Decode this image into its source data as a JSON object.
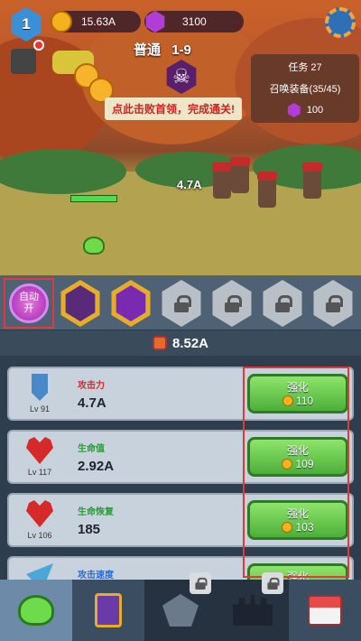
{
  "player": {
    "level": "1"
  },
  "resources": {
    "coins": "15.63A",
    "gems": "3100"
  },
  "stage": {
    "mode": "普通",
    "number": "1-9"
  },
  "boss_hint": "点此击败首领，完成通关!",
  "quest": {
    "title": "任务 27",
    "desc": "召唤装备(35/45)",
    "reward": "100"
  },
  "battle": {
    "damage_text": "4.7A"
  },
  "auto_button": {
    "line1": "自动",
    "line2": "开"
  },
  "power": "8.52A",
  "upgrades": [
    {
      "name": "攻击力",
      "name_color": "#d62a2a",
      "level": "Lv 91",
      "value": "4.7A",
      "button": "强化",
      "cost": "110"
    },
    {
      "name": "生命值",
      "name_color": "#2a9a3a",
      "level": "Lv 117",
      "value": "2.92A",
      "button": "强化",
      "cost": "109"
    },
    {
      "name": "生命恢复",
      "name_color": "#2a9a3a",
      "level": "Lv 106",
      "value": "185",
      "button": "强化",
      "cost": "103"
    },
    {
      "name": "攻击速度",
      "name_color": "#2a6ad6",
      "level": "",
      "value": "",
      "button": "强化",
      "cost": ""
    }
  ],
  "icons": {
    "nav": [
      "slime-icon",
      "card-icon",
      "battle-icon",
      "castle-icon",
      "shop-icon"
    ]
  }
}
